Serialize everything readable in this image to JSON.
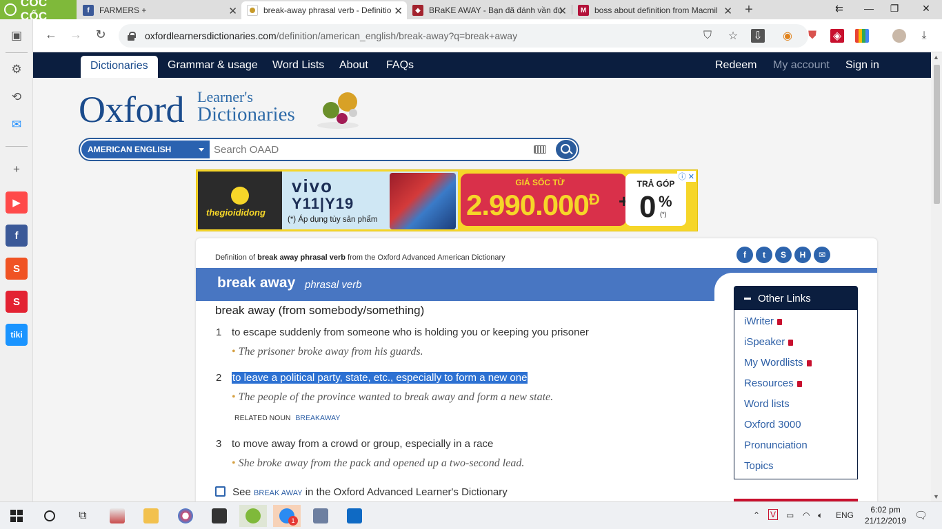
{
  "browser": {
    "brand": "CỐC CỐC",
    "tabs": [
      {
        "label": "FARMERS +",
        "favicon": "facebook-icon",
        "active": false
      },
      {
        "label": "break-away phrasal verb - Definitio",
        "favicon": "oxford-icon",
        "active": true
      },
      {
        "label": "BRaKE AWAY - Bạn đã đánh vần đú",
        "favicon": "cambridge-icon",
        "active": false
      },
      {
        "label": "boss about definition from Macmil",
        "favicon": "macmillan-icon",
        "active": false
      }
    ],
    "url_host": "oxfordlearnersdictionaries.com",
    "url_path": "/definition/american_english/break-away?q=break+away"
  },
  "site": {
    "nav": {
      "left": [
        "Dictionaries",
        "Grammar & usage",
        "Word Lists",
        "About",
        "FAQs"
      ],
      "right": [
        "Redeem",
        "My account",
        "Sign in"
      ]
    },
    "logo": {
      "main": "Oxford",
      "line1": "Learner's",
      "line2": "Dictionaries"
    },
    "search": {
      "dictionary": "AMERICAN ENGLISH",
      "placeholder": "Search OAAD"
    }
  },
  "ad": {
    "store": "thegioididong",
    "brand": "vivo",
    "models": "Y11|Y19",
    "note": "(*) Áp dụng tùy sản phẩm",
    "price_label": "GIÁ SỐC TỪ",
    "price": "2.990.000",
    "currency": "Đ",
    "plus": "+",
    "installment_label": "TRẢ GÓP",
    "installment_value": "0",
    "installment_unit": "%",
    "installment_note": "(*)"
  },
  "entry": {
    "source_prefix": "Definition of",
    "source_term": "break away phrasal verb",
    "source_suffix": "from the Oxford Advanced American Dictionary",
    "headword": "break away",
    "pos": "phrasal verb",
    "phrase": "break away (from somebody/something)",
    "senses": [
      {
        "num": "1",
        "def": "to escape suddenly from someone who is holding you or keeping you prisoner",
        "example": "The prisoner broke away from his guards.",
        "highlighted": false
      },
      {
        "num": "2",
        "def": "to leave a political party, state, etc., especially to form a new one",
        "example": "The people of the province wanted to break away and form a new state.",
        "highlighted": true
      },
      {
        "num": "3",
        "def": "to move away from a crowd or group, especially in a race",
        "example": "She broke away from the pack and opened up a two-second lead.",
        "highlighted": false
      }
    ],
    "related_label": "RELATED NOUN",
    "related_link": "BREAKAWAY",
    "see_prefix": "See",
    "see_link": "BREAK AWAY",
    "see_suffix": "in the Oxford Advanced Learner's Dictionary"
  },
  "other_links": {
    "title": "Other Links",
    "items": [
      {
        "label": "iWriter",
        "locked": true
      },
      {
        "label": "iSpeaker",
        "locked": true
      },
      {
        "label": "My Wordlists",
        "locked": true
      },
      {
        "label": "Resources",
        "locked": true
      },
      {
        "label": "Word lists",
        "locked": false
      },
      {
        "label": "Oxford 3000",
        "locked": false
      },
      {
        "label": "Pronunciation",
        "locked": false
      },
      {
        "label": "Topics",
        "locked": false
      }
    ]
  },
  "taskbar": {
    "language": "ENG",
    "time": "6:02 pm",
    "date": "21/12/2019",
    "zalo_badge": "1"
  },
  "colors": {
    "oxford_navy": "#0b1e3f",
    "oxford_blue": "#4876c2",
    "highlight": "#2d71d2",
    "coccoc_green": "#7fb93a"
  }
}
